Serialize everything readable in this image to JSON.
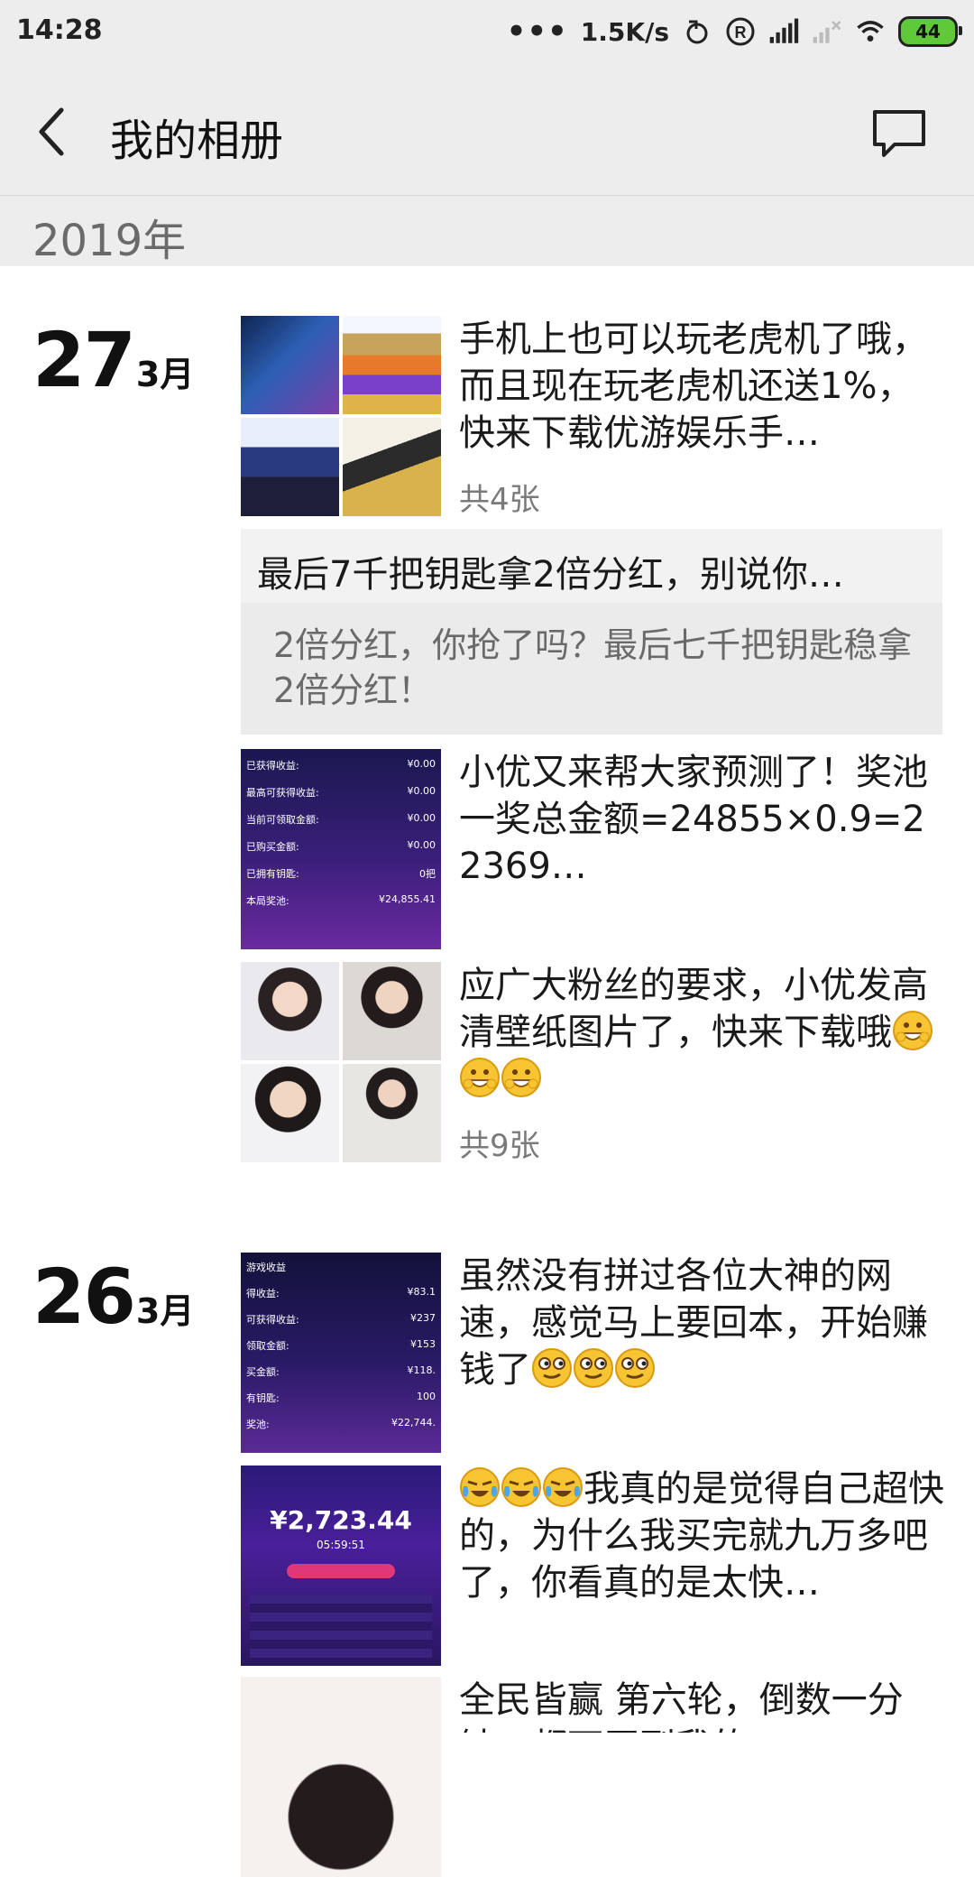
{
  "status_bar": {
    "time": "14:28",
    "dots": "•••",
    "network_speed": "1.5K/s",
    "battery": "44"
  },
  "header": {
    "title": "我的相册",
    "back_icon": "chevron-left-icon",
    "action_icon": "comment-icon"
  },
  "year": "2019年",
  "days": [
    {
      "day": "27",
      "month": "3月",
      "posts": [
        {
          "type": "images",
          "text": "手机上也可以玩老虎机了哦，而且现在玩老虎机还送1%，快来下载优游娱乐手…",
          "count": "共4张"
        },
        {
          "type": "share",
          "title": "最后7千把钥匙拿2倍分红，别说你…",
          "desc": "2倍分红，你抢了吗？最后七千把钥匙稳拿2倍分红！"
        },
        {
          "type": "image",
          "text": "小优又来帮大家预测了！奖池一奖总金额=24855×0.9=22369…",
          "image_text": {
            "rows": [
              [
                "已获得收益:",
                "¥0.00"
              ],
              [
                "最高可获得收益:",
                "¥0.00"
              ],
              [
                "当前可领取金额:",
                "¥0.00"
              ],
              [
                "已购买金额:",
                "¥0.00"
              ],
              [
                "已拥有钥匙:",
                "0把"
              ],
              [
                "本局奖池:",
                "¥24,855.41"
              ]
            ]
          }
        },
        {
          "type": "images",
          "text": "应广大粉丝的要求，小优发高清壁纸图片了，快来下载哦",
          "count": "共9张",
          "emoji": [
            "grin-icon",
            "grin-icon",
            "grin-icon"
          ]
        }
      ]
    },
    {
      "day": "26",
      "month": "3月",
      "posts": [
        {
          "type": "image",
          "text": "虽然没有拼过各位大神的网速，感觉马上要回本，开始赚钱了",
          "emoji": [
            "grimace-icon",
            "grimace-icon",
            "grimace-icon"
          ],
          "image_text": {
            "rows": [
              [
                "游戏收益",
                ""
              ],
              [
                "得收益:",
                "¥83.1"
              ],
              [
                "可获得收益:",
                "¥237"
              ],
              [
                "领取金额:",
                "¥153"
              ],
              [
                "买金额:",
                "¥118."
              ],
              [
                "有钥匙:",
                "100"
              ],
              [
                "奖池:",
                "¥22,744."
              ]
            ]
          }
        },
        {
          "type": "image",
          "text": "我真的是觉得自己超快的，为什么我买完就九万多吧了，你看真的是太快…",
          "emoji": [
            "tears-of-joy-icon",
            "tears-of-joy-icon",
            "tears-of-joy-icon"
          ],
          "image_text": {
            "amount": "¥2,723.44",
            "timer": "05:59:51"
          }
        },
        {
          "type": "image",
          "text": "全民皆赢 第六轮，倒数一分钟，都下买到我的"
        }
      ]
    }
  ],
  "colors": {
    "bar_bg": "#ededed",
    "text_primary": "#1a1a1a",
    "text_secondary": "#7a7a7a",
    "card_bg": "#f2f2f2"
  }
}
